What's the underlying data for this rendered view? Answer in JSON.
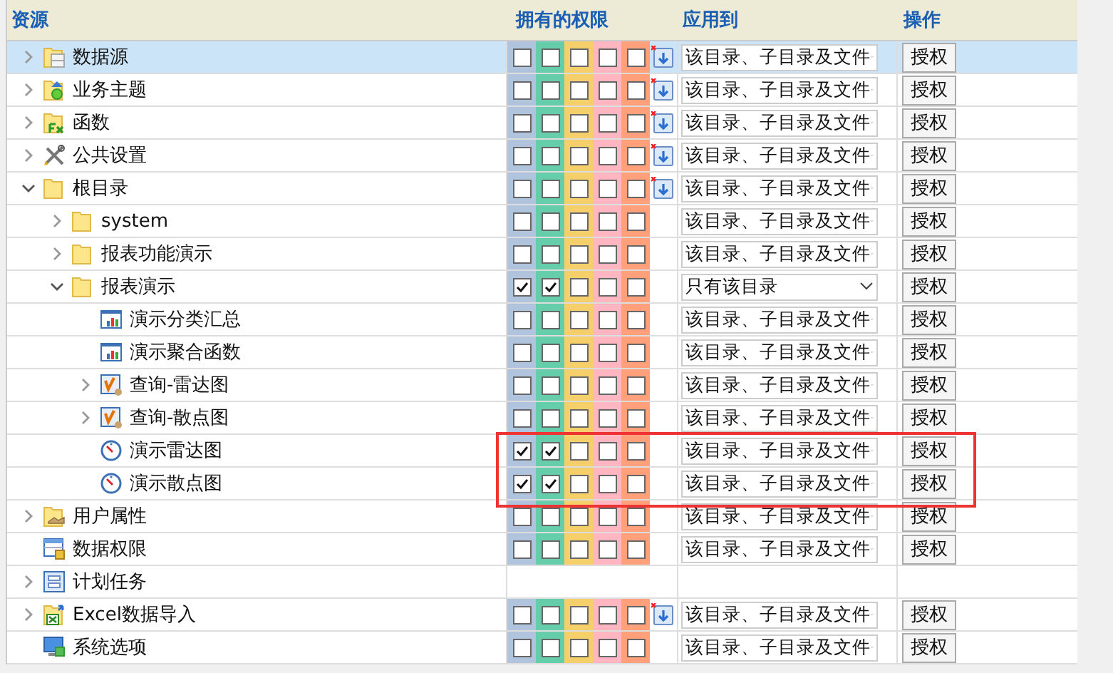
{
  "columns": [
    "资源",
    "拥有的权限",
    "应用到",
    "操作"
  ],
  "rows": [
    {
      "name": "数据源",
      "kind": "folder-db",
      "expanded": false,
      "selected": true,
      "highlighted": false,
      "permissions": [
        false,
        false,
        false,
        false,
        false
      ],
      "import_icon": true,
      "apply_to": "该目录、子目录及文件",
      "action": "授权"
    },
    {
      "name": "业务主题",
      "kind": "folder-theme",
      "expanded": false,
      "selected": false,
      "highlighted": false,
      "permissions": [
        false,
        false,
        false,
        false,
        false
      ],
      "import_icon": true,
      "apply_to": "该目录、子目录及文件",
      "action": "授权"
    },
    {
      "name": "函数",
      "kind": "folder-fx",
      "expanded": false,
      "selected": false,
      "highlighted": false,
      "permissions": [
        false,
        false,
        false,
        false,
        false
      ],
      "import_icon": true,
      "apply_to": "该目录、子目录及文件",
      "action": "授权"
    },
    {
      "name": "公共设置",
      "kind": "tools",
      "expanded": false,
      "selected": false,
      "highlighted": false,
      "permissions": [
        false,
        false,
        false,
        false,
        false
      ],
      "import_icon": true,
      "apply_to": "该目录、子目录及文件",
      "action": "授权"
    },
    {
      "name": "根目录",
      "kind": "folder",
      "expanded": true,
      "selected": false,
      "highlighted": false,
      "permissions": [
        false,
        false,
        false,
        false,
        false
      ],
      "import_icon": true,
      "apply_to": "该目录、子目录及文件",
      "action": "授权",
      "children": [
        {
          "name": "system",
          "kind": "folder",
          "expanded": false,
          "selected": false,
          "highlighted": false,
          "permissions": [
            false,
            false,
            false,
            false,
            false
          ],
          "import_icon": false,
          "apply_to": "该目录、子目录及文件",
          "action": "授权"
        },
        {
          "name": "报表功能演示",
          "kind": "folder",
          "expanded": false,
          "selected": false,
          "highlighted": false,
          "permissions": [
            false,
            false,
            false,
            false,
            false
          ],
          "import_icon": false,
          "apply_to": "该目录、子目录及文件",
          "action": "授权"
        },
        {
          "name": "报表演示",
          "kind": "folder",
          "expanded": true,
          "selected": false,
          "highlighted": false,
          "permissions": [
            true,
            true,
            false,
            false,
            false
          ],
          "import_icon": false,
          "apply_to": "只有该目录",
          "action": "授权",
          "children": [
            {
              "name": "演示分类汇总",
              "kind": "report",
              "selected": false,
              "highlighted": false,
              "permissions": [
                false,
                false,
                false,
                false,
                false
              ],
              "import_icon": false,
              "apply_to": "该目录、子目录及文件",
              "action": "授权"
            },
            {
              "name": "演示聚合函数",
              "kind": "report",
              "selected": false,
              "highlighted": false,
              "permissions": [
                false,
                false,
                false,
                false,
                false
              ],
              "import_icon": false,
              "apply_to": "该目录、子目录及文件",
              "action": "授权"
            },
            {
              "name": "查询-雷达图",
              "kind": "query",
              "expanded": false,
              "selected": false,
              "highlighted": false,
              "permissions": [
                false,
                false,
                false,
                false,
                false
              ],
              "import_icon": false,
              "apply_to": "该目录、子目录及文件",
              "action": "授权"
            },
            {
              "name": "查询-散点图",
              "kind": "query",
              "expanded": false,
              "selected": false,
              "highlighted": false,
              "permissions": [
                false,
                false,
                false,
                false,
                false
              ],
              "import_icon": false,
              "apply_to": "该目录、子目录及文件",
              "action": "授权"
            },
            {
              "name": "演示雷达图",
              "kind": "dashboard",
              "selected": false,
              "highlighted": true,
              "permissions": [
                true,
                true,
                false,
                false,
                false
              ],
              "import_icon": false,
              "apply_to": "该目录、子目录及文件",
              "action": "授权"
            },
            {
              "name": "演示散点图",
              "kind": "dashboard",
              "selected": false,
              "highlighted": true,
              "permissions": [
                true,
                true,
                false,
                false,
                false
              ],
              "import_icon": false,
              "apply_to": "该目录、子目录及文件",
              "action": "授权"
            }
          ]
        }
      ]
    },
    {
      "name": "用户属性",
      "kind": "folder-user",
      "expanded": false,
      "selected": false,
      "highlighted": false,
      "permissions": [
        false,
        false,
        false,
        false,
        false
      ],
      "import_icon": false,
      "apply_to": "该目录、子目录及文件",
      "action": "授权"
    },
    {
      "name": "数据权限",
      "kind": "data-lock",
      "selected": false,
      "highlighted": false,
      "permissions": [
        false,
        false,
        false,
        false,
        false
      ],
      "import_icon": false,
      "apply_to": "该目录、子目录及文件",
      "action": "授权"
    },
    {
      "name": "计划任务",
      "kind": "schedule",
      "expanded": false,
      "selected": false,
      "highlighted": false
    },
    {
      "name": "Excel数据导入",
      "kind": "excel",
      "expanded": false,
      "selected": false,
      "highlighted": false,
      "permissions": [
        false,
        false,
        false,
        false,
        false
      ],
      "import_icon": true,
      "apply_to": "该目录、子目录及文件",
      "action": "授权"
    },
    {
      "name": "系统选项",
      "kind": "system",
      "selected": false,
      "highlighted": false,
      "permissions": [
        false,
        false,
        false,
        false,
        false
      ],
      "import_icon": false,
      "apply_to": "该目录、子目录及文件",
      "action": "授权"
    }
  ]
}
